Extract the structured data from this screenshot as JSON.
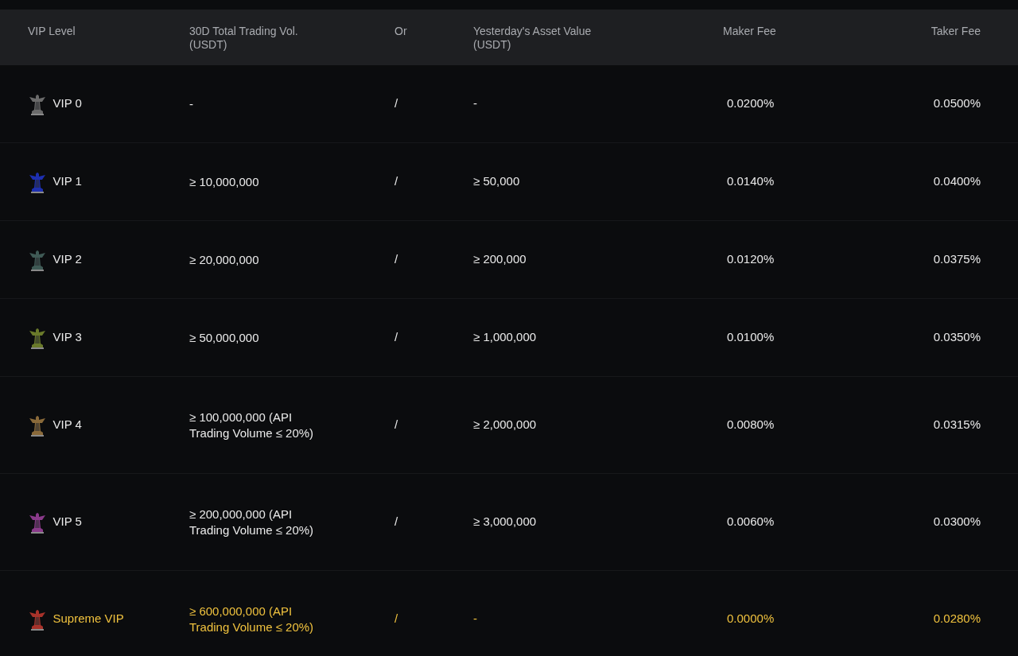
{
  "table": {
    "columns": [
      "VIP Level",
      "30D Total Trading Vol. (USDT)",
      "Or",
      "Yesterday's Asset Value (USDT)",
      "Maker Fee",
      "Taker Fee"
    ],
    "rows": [
      {
        "level": "VIP 0",
        "volume": "-",
        "or": "/",
        "assets": "-",
        "maker_fee": "0.0200%",
        "taker_fee": "0.0500%",
        "color": "#6b6b6b",
        "highlighted": false
      },
      {
        "level": "VIP 1",
        "volume": "≥ 10,000,000",
        "or": "/",
        "assets": "≥ 50,000",
        "maker_fee": "0.0140%",
        "taker_fee": "0.0400%",
        "color": "#1d2fb0",
        "highlighted": false
      },
      {
        "level": "VIP 2",
        "volume": "≥ 20,000,000",
        "or": "/",
        "assets": "≥ 200,000",
        "maker_fee": "0.0120%",
        "taker_fee": "0.0375%",
        "color": "#3f5a55",
        "highlighted": false
      },
      {
        "level": "VIP 3",
        "volume": "≥ 50,000,000",
        "or": "/",
        "assets": "≥ 1,000,000",
        "maker_fee": "0.0100%",
        "taker_fee": "0.0350%",
        "color": "#6a7a2a",
        "highlighted": false
      },
      {
        "level": "VIP 4",
        "volume": "≥ 100,000,000 (API Trading Volume ≤ 20%)",
        "or": "/",
        "assets": "≥ 2,000,000",
        "maker_fee": "0.0080%",
        "taker_fee": "0.0315%",
        "color": "#8a6a3a",
        "highlighted": false
      },
      {
        "level": "VIP 5",
        "volume": "≥ 200,000,000 (API Trading Volume ≤ 20%)",
        "or": "/",
        "assets": "≥ 3,000,000",
        "maker_fee": "0.0060%",
        "taker_fee": "0.0300%",
        "color": "#8a3a8a",
        "highlighted": false
      },
      {
        "level": "Supreme VIP",
        "volume": "≥ 600,000,000 (API Trading Volume ≤ 20%)",
        "or": "/",
        "assets": "-",
        "maker_fee": "0.0000%",
        "taker_fee": "0.0280%",
        "color": "#a8322a",
        "highlighted": true
      }
    ]
  }
}
